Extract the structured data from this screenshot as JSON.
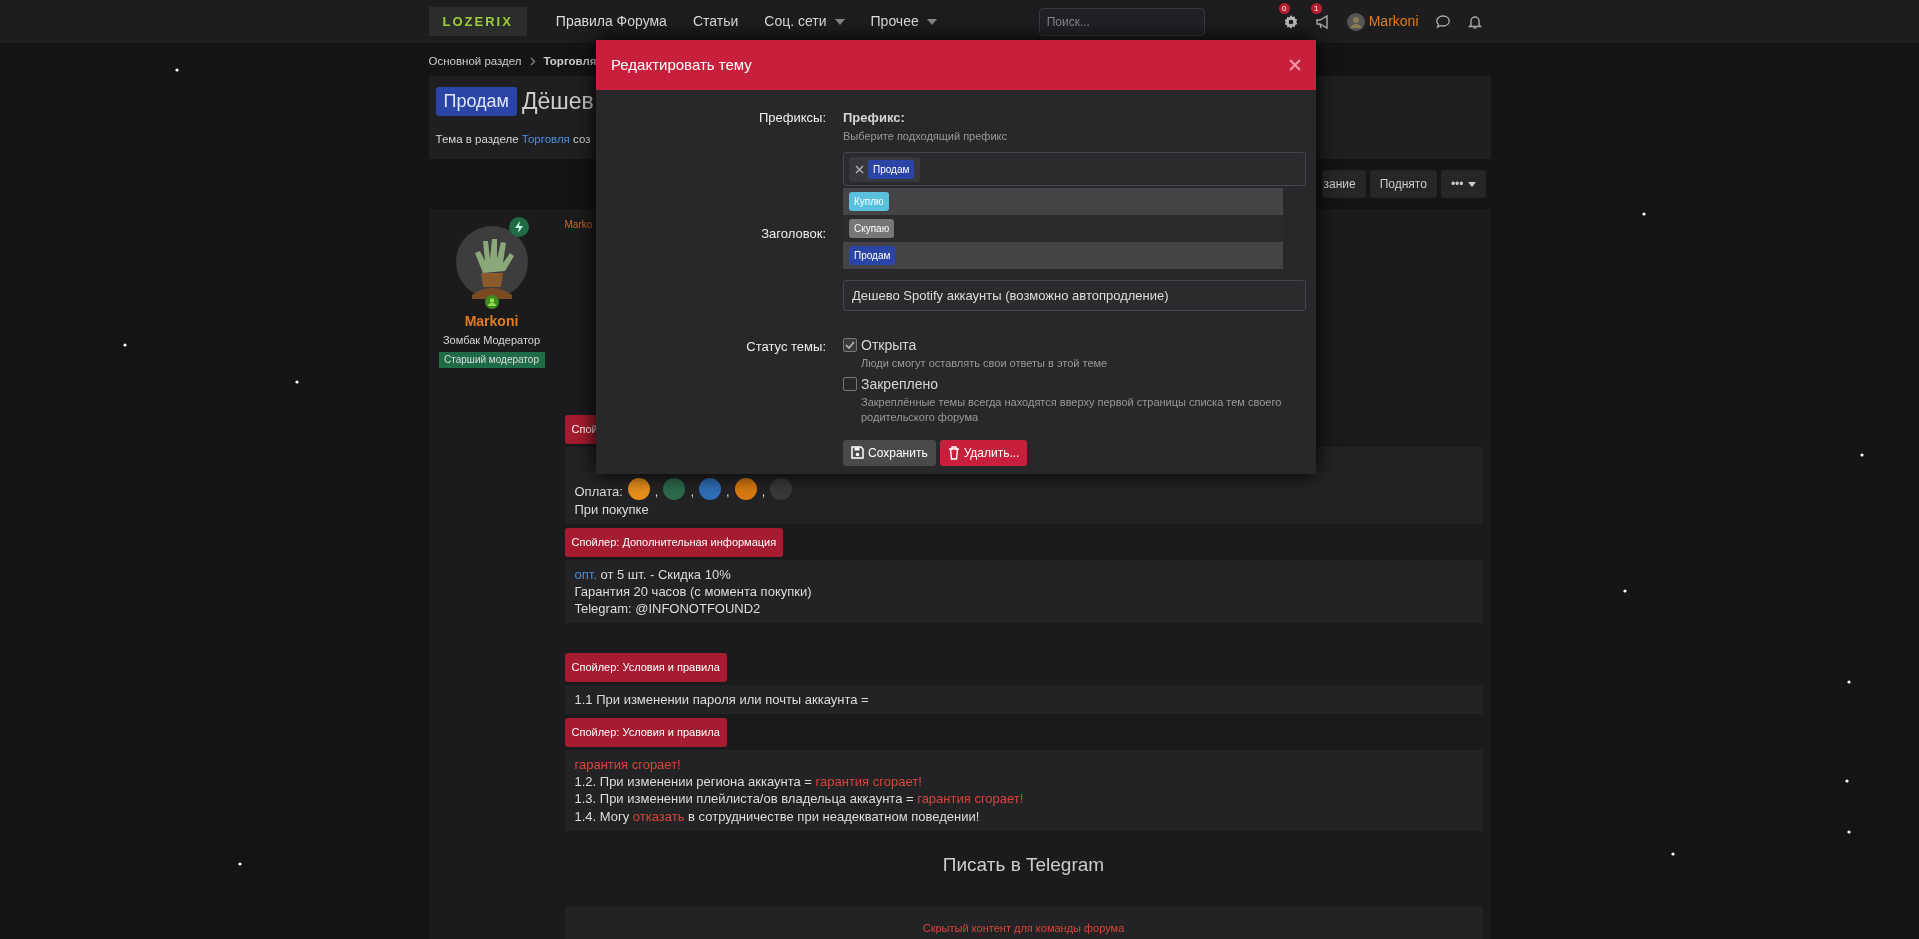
{
  "navbar": {
    "logo": "LOZERIX",
    "links": [
      {
        "label": "Правила Форума",
        "dropdown": false
      },
      {
        "label": "Статьи",
        "dropdown": false
      },
      {
        "label": "Соц. сети",
        "dropdown": true
      },
      {
        "label": "Прочее",
        "dropdown": true
      }
    ],
    "search": {
      "placeholder": "Поиск..."
    },
    "alerts": [
      {
        "kind": "settings",
        "count": "0"
      },
      {
        "kind": "megaphone",
        "count": "1"
      }
    ],
    "user": {
      "name": "Markoni"
    },
    "tools": [
      {
        "kind": "chat"
      },
      {
        "kind": "bell"
      }
    ]
  },
  "breadcrumb": [
    "Основной раздел",
    "Торговля"
  ],
  "thread": {
    "prefix": "Продам",
    "title": "Дёшев",
    "meta_text": "Тема в разделе",
    "meta_link": "Торговля",
    "meta_rest": "соз"
  },
  "thread_actions": [
    {
      "label": "зание",
      "caret": false
    },
    {
      "label": "Поднято",
      "caret": false
    },
    {
      "label": "•••",
      "caret": true
    }
  ],
  "post": {
    "author": {
      "name": "Markoni",
      "title": "Зомбак Модератор",
      "banner": "Старший модератор"
    },
    "author_link": "Marko",
    "blocks": [
      {
        "kind": "spoiler",
        "label": "Спой"
      },
      {
        "kind": "payment",
        "label": "Оплата:",
        "icons": [
          {
            "color": "#e8901c",
            "separator": ","
          },
          {
            "color": "#2e6b4e",
            "separator": ","
          },
          {
            "color": "#2f6fb8",
            "separator": ","
          },
          {
            "color": "#d97a12",
            "separator": ","
          },
          {
            "color": "#3a3a3a"
          }
        ],
        "lines": [
          [
            {
              "text": "При покупке",
              "kind": "plain"
            }
          ]
        ]
      },
      {
        "kind": "spoiler",
        "label": "Спойлер: Дополнительная информация"
      },
      {
        "kind": "box",
        "lines": [
          [
            {
              "text": "опт.",
              "kind": "link"
            },
            {
              "text": " от 5 шт. - Скидка 10%",
              "kind": "plain"
            }
          ],
          [
            {
              "text": "Гарантия 20 часов (с момента покупки)",
              "kind": "plain"
            }
          ],
          [
            {
              "text": "Telegram: @INFONOTFOUND2",
              "kind": "plain"
            }
          ]
        ]
      },
      {
        "kind": "gap"
      },
      {
        "kind": "spoiler",
        "label": "Спойлер: Условия и правила"
      },
      {
        "kind": "box",
        "lines": [
          [
            {
              "text": "1.1 При изменении пароля или почты аккаунта =",
              "kind": "plain"
            }
          ]
        ]
      },
      {
        "kind": "spoiler",
        "label": "Спойлер: Условия и правила"
      },
      {
        "kind": "box",
        "lines": [
          [
            {
              "text": "гарантия сгорает!",
              "kind": "alert"
            }
          ],
          [
            {
              "text": "1.2. При изменении региона аккаунта = ",
              "kind": "plain"
            },
            {
              "text": "гарантия сгорает!",
              "kind": "alert"
            }
          ],
          [
            {
              "text": "1.3. При изменении плейлиста/ов владельца аккаунта = ",
              "kind": "plain"
            },
            {
              "text": "гарантия сгорает!",
              "kind": "alert"
            }
          ],
          [
            {
              "text": "1.4. Могу ",
              "kind": "plain"
            },
            {
              "text": "отказать",
              "kind": "alert"
            },
            {
              "text": " в сотрудничестве при неадекватном поведении!",
              "kind": "plain"
            }
          ]
        ]
      },
      {
        "kind": "heading",
        "label": "Писать в Telegram"
      },
      {
        "kind": "hidden",
        "label": "Скрытый контент для команды форума"
      }
    ]
  },
  "modal": {
    "title": "Редактировать тему",
    "prefixes": {
      "label": "Префиксы:",
      "heading": "Префикс:",
      "hint": "Выберите подходящий префикс",
      "chosen": [
        {
          "label": "Продам",
          "color": "#2b45a6"
        }
      ],
      "options": [
        {
          "label": "Куплю",
          "color": "#5bc0de",
          "highlighted": true
        },
        {
          "label": "Скупаю",
          "color": "#777777",
          "highlighted": false
        },
        {
          "label": "Продам",
          "color": "#2b45a6",
          "highlighted": true
        }
      ]
    },
    "title_field": {
      "label": "Заголовок:",
      "value": "Дешево Spotify аккаунты (возможно автопродление)"
    },
    "status": {
      "label": "Статус темы:",
      "options": [
        {
          "label": "Открыта",
          "hint": "Люди смогут оставлять свои ответы в этой теме",
          "checked": true
        },
        {
          "label": "Закреплено",
          "hint": "Закреплённые темы всегда находятся вверху первой страницы списка тем своего родительского форума",
          "checked": false
        }
      ]
    },
    "buttons": [
      {
        "kind": "save",
        "label": "Сохранить"
      },
      {
        "kind": "delete",
        "label": "Удалить..."
      }
    ]
  }
}
